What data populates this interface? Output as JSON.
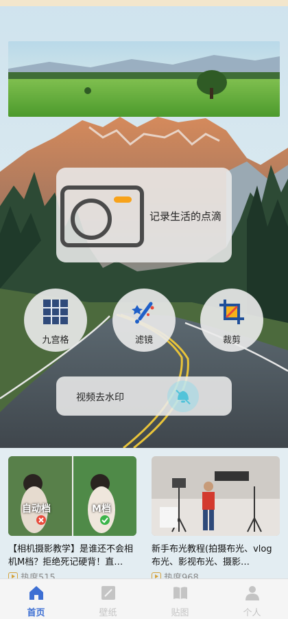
{
  "camera_card": {
    "label": "记录生活的点滴"
  },
  "tools": [
    {
      "label": "九宫格",
      "icon": "grid-icon"
    },
    {
      "label": "滤镜",
      "icon": "magic-wand-icon"
    },
    {
      "label": "裁剪",
      "icon": "crop-icon"
    }
  ],
  "video_card": {
    "label": "视频去水印",
    "icon": "watermark-eraser-icon"
  },
  "feed": [
    {
      "title": "【相机摄影教学】是谁还不会相机M档？拒绝死记硬背！直…",
      "heat": "热度515",
      "thumb_left_label": "自动档",
      "thumb_right_label": "M档"
    },
    {
      "title": "新手布光教程(拍摄布光、vlog布光、影视布光、摄影…",
      "heat": "热度968"
    }
  ],
  "nav": [
    {
      "label": "首页",
      "icon": "home-icon",
      "active": true
    },
    {
      "label": "壁纸",
      "icon": "wallpaper-icon",
      "active": false
    },
    {
      "label": "贴图",
      "icon": "sticker-book-icon",
      "active": false
    },
    {
      "label": "个人",
      "icon": "person-icon",
      "active": false
    }
  ],
  "colors": {
    "accent": "#3d6fd3",
    "camera_dot": "#f7a21a",
    "inactive": "#c4c4c4"
  }
}
